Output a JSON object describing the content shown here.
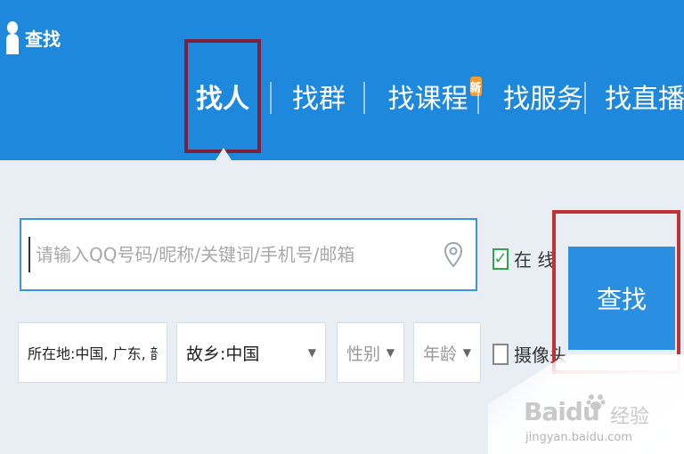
{
  "window": {
    "title": "查找"
  },
  "tabs": [
    {
      "label": "找人",
      "active": true
    },
    {
      "label": "找群",
      "active": false
    },
    {
      "label": "找课程",
      "active": false,
      "badge": "新"
    },
    {
      "label": "找服务",
      "active": false
    },
    {
      "label": "找直播",
      "active": false
    }
  ],
  "search": {
    "placeholder": "请输入QQ号码/昵称/关键词/手机号/邮箱",
    "value": ""
  },
  "filters": {
    "online": {
      "label": "在 线",
      "checked": true
    },
    "camera": {
      "label": "摄像头",
      "checked": false
    },
    "location": {
      "value": "所在地:中国, 广东, 韶关"
    },
    "hometown": {
      "value": "故乡:中国"
    },
    "gender": {
      "placeholder": "性别"
    },
    "age": {
      "placeholder": "年龄"
    }
  },
  "find_button": {
    "label": "查找"
  },
  "watermark": {
    "logo": "Baidu",
    "cn": "经验",
    "url": "jingyan.baidu.com"
  },
  "colors": {
    "header": "#1e88dc",
    "button": "#2a8fe0",
    "highlight_dark": "#7e1f3b",
    "highlight_red": "#c03335"
  }
}
